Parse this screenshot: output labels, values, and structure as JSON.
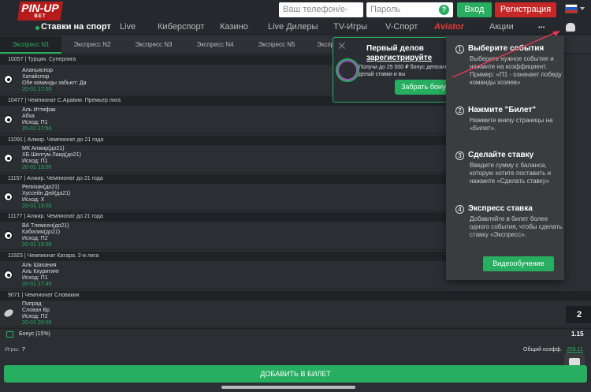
{
  "header": {
    "logo_text": "PIN-UP",
    "logo_sub": "BET",
    "phone_placeholder": "Ваш телефон/e-mail",
    "password_placeholder": "Пароль",
    "login_label": "Вход",
    "register_label": "Регистрация"
  },
  "nav": {
    "sport_label": "Ставки на спорт",
    "items": [
      "Live",
      "Киберспорт",
      "Казино",
      "Live Дилеры",
      "TV-Игры",
      "V-Спорт",
      "Aviator",
      "Акции"
    ],
    "more_label": "•••"
  },
  "express_tabs": [
    "Экспресс N1",
    "Экспресс N2",
    "Экспресс N3",
    "Экспресс N4",
    "Экспресс N5",
    "Экспр"
  ],
  "events": [
    {
      "group": "10057  |  Турция. Суперлига",
      "lines": [
        "Аланьяспор",
        "Хатайспор",
        "Обе команды забьют: Да"
      ],
      "time": "20-01 17:00"
    },
    {
      "group": "10477  |  Чемпионат С.Аравии. Премьер лига",
      "lines": [
        "Аль Иттифак",
        "Абха",
        "Исход: П1"
      ],
      "time": "20-01 17:50"
    },
    {
      "group": "11091  |  Алжир. Чемпионат до 21 года",
      "lines": [
        "МК Алжир(до21)",
        "ХБ Шелгум Лаид(до21)",
        "Исход: П1"
      ],
      "time": "20-01 13:00"
    },
    {
      "group": "11157  |  Алжир. Чемпионат до 21 года",
      "lines": [
        "Релизан(до21)",
        "Хуссейн Дей(до21)",
        "Исход: Х"
      ],
      "time": "20-01 13:00"
    },
    {
      "group": "11177  |  Алжир. Чемпионат до 21 года",
      "lines": [
        "ВА Тлемсен(до21)",
        "Кабилия(до21)",
        "Исход: П2"
      ],
      "time": "20-01 13:00"
    },
    {
      "group": "11923  |  Чемпионат Катара. 2-я лига",
      "lines": [
        "Аль Шахания",
        "Аль Кхуритият",
        "Исход: П1"
      ],
      "time": "20-01 17:45"
    },
    {
      "group": "9071  |  Чемпионат Словакии",
      "lines": [
        "Попрад",
        "Слован Бр",
        "Исход: П2"
      ],
      "time": "20-01 20:00"
    }
  ],
  "promo": {
    "title_line1": "Первый делов",
    "title_line2": "зарегистрируйте",
    "text": "Получи до 25 000 ₽ бонус депозит, делай ставки и вы",
    "button": "Забрать бонус"
  },
  "help": {
    "steps": [
      {
        "num": "1",
        "title": "Выберите события",
        "text": "Выберите нужное событие и нажмите на коэффициент. Пример: «П1 - означает победу команды хозяев»"
      },
      {
        "num": "2",
        "title": "Нажмите \"Билет\"",
        "text": "Нажмите внизу страницы на «Билет»."
      },
      {
        "num": "3",
        "title": "Сделайте ставку",
        "text": "Введите сумму с баланса, которую хотите поставить и нажмите «Сделать ставку»"
      },
      {
        "num": "4",
        "title": "Экспресс ставка",
        "text": "Добавляйте в билет более одного события, чтобы сделать ставку «Экспресс»."
      }
    ],
    "video_button": "Видеообучение"
  },
  "footer": {
    "bonus_label": "Бонус (15%)",
    "bonus_value": "1.15",
    "games_label": "Игры:",
    "games_count": "7",
    "total_label": "Общий коэфф.",
    "total_value": "256.11",
    "side_value": "2",
    "add_button": "ДОБАВИТЬ В БИЛЕТ"
  },
  "colors": {
    "accent": "#27ae60",
    "danger": "#c62828",
    "background": "#2b2f33"
  },
  "icons": [
    "help-icon",
    "user-settings-icon",
    "soccer-ball-icon",
    "hockey-puck-icon",
    "gift-icon",
    "chat-icon",
    "close-icon",
    "chevron-down-icon"
  ]
}
